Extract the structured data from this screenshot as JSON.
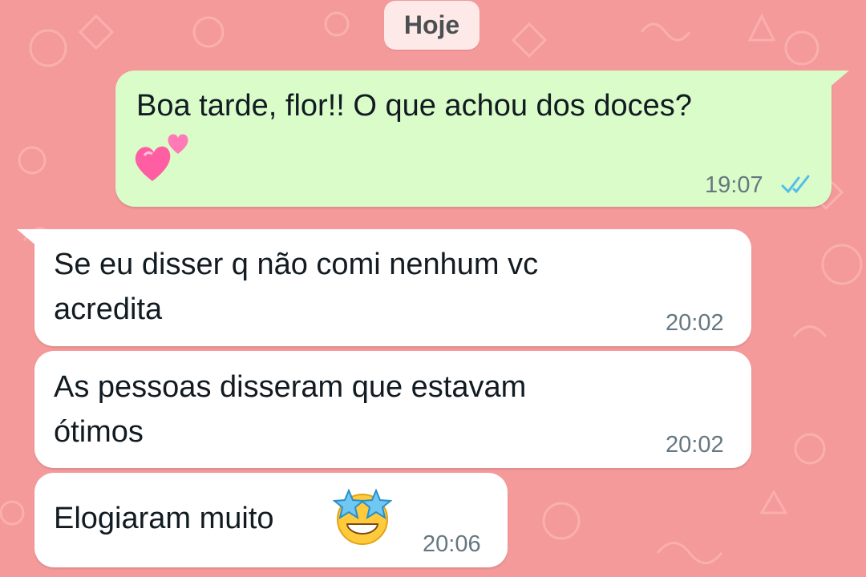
{
  "chat": {
    "date_label": "Hoje",
    "messages": [
      {
        "direction": "outgoing",
        "line1": "Boa tarde, flor!! O que achou dos doces?",
        "emoji": "two-hearts",
        "time": "19:07",
        "status": "read"
      },
      {
        "direction": "incoming",
        "line1": "Se eu disser q não comi nenhum vc",
        "line2": "acredita",
        "time": "20:02"
      },
      {
        "direction": "incoming",
        "line1": "As pessoas disseram que estavam",
        "line2": "ótimos",
        "time": "20:02"
      },
      {
        "direction": "incoming",
        "line1": "Elogiaram muito",
        "emoji": "star-struck",
        "time": "20:06"
      }
    ]
  },
  "colors": {
    "wallpaper": "#f59a9a",
    "outgoing_bubble": "#dafcc9",
    "incoming_bubble": "#ffffff",
    "read_ticks": "#53bdeb"
  }
}
